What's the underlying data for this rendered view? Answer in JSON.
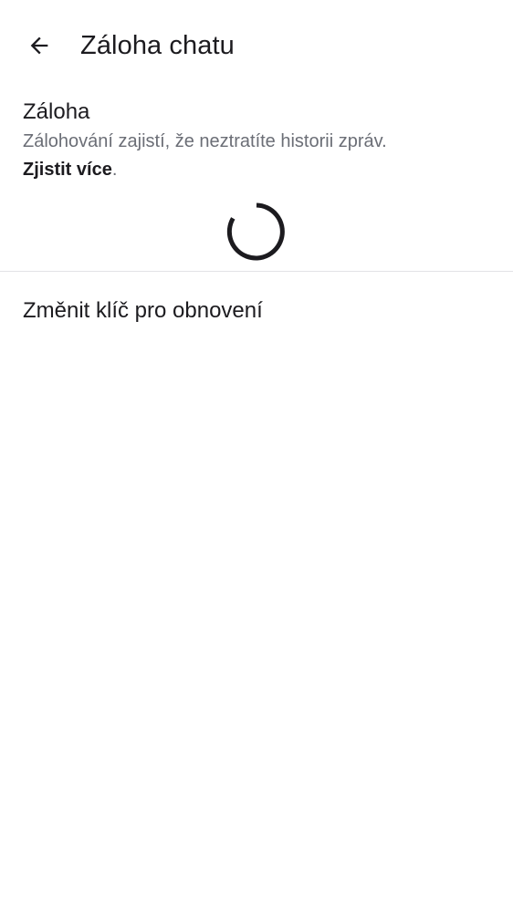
{
  "header": {
    "back_icon": "arrow-back-icon",
    "title": "Záloha chatu"
  },
  "backup": {
    "title": "Záloha",
    "description": "Zálohování zajistí, že neztratíte historii zpráv.",
    "learn_more": "Zjistit více",
    "learn_more_suffix": ".",
    "loading_icon": "progress-spinner-icon"
  },
  "actions": {
    "change_recovery_key": "Změnit klíč pro obnovení"
  },
  "colors": {
    "text_primary": "#1c1b1f",
    "text_secondary": "#6b6e76",
    "divider": "#e3e3e6",
    "background": "#ffffff"
  }
}
